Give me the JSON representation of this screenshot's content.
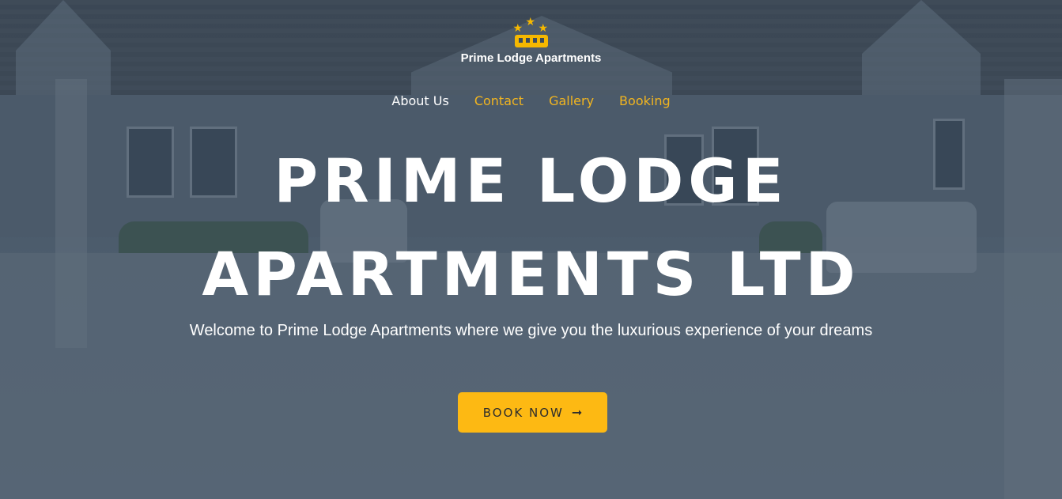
{
  "brand": {
    "name": "Prime Lodge Apartments",
    "accent_color": "#fdb913",
    "logo_icon": "hotel-stars-logo-icon"
  },
  "nav": {
    "items": [
      {
        "label": "About Us",
        "active": true
      },
      {
        "label": "Contact",
        "active": false
      },
      {
        "label": "Gallery",
        "active": false
      },
      {
        "label": "Booking",
        "active": false
      }
    ]
  },
  "hero": {
    "title": "PRIME LODGE APARTMENTS LTD",
    "subtitle": "Welcome to Prime Lodge Apartments where we give you the luxurious experience of your dreams",
    "cta_label": "BOOK NOW",
    "cta_icon": "arrow-right-icon"
  }
}
